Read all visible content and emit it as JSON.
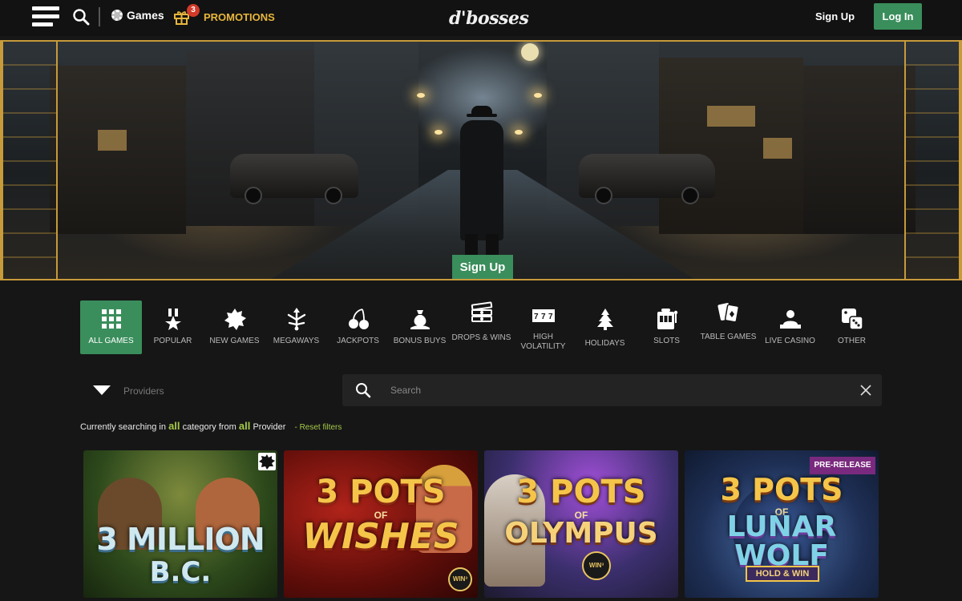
{
  "header": {
    "games_label": "Games",
    "promotions_count": "3",
    "promotions_label": "PROMOTIONS",
    "logo_text": "d'bosses",
    "signup_label": "Sign Up",
    "login_label": "Log In"
  },
  "hero": {
    "signup_label": "Sign Up"
  },
  "categories": [
    {
      "label": "ALL GAMES",
      "icon": "grid-icon",
      "active": true
    },
    {
      "label": "POPULAR",
      "icon": "medal-icon",
      "active": false
    },
    {
      "label": "NEW GAMES",
      "icon": "new-badge-icon",
      "active": false
    },
    {
      "label": "MEGAWAYS",
      "icon": "megaways-icon",
      "active": false
    },
    {
      "label": "JACKPOTS",
      "icon": "cherries-icon",
      "active": false
    },
    {
      "label": "BONUS BUYS",
      "icon": "money-bag-icon",
      "active": false
    },
    {
      "label": "DROPS & WINS",
      "icon": "coin-stack-icon",
      "active": false
    },
    {
      "label": "HIGH VOLATILITY",
      "icon": "triple-seven-icon",
      "active": false
    },
    {
      "label": "HOLIDAYS",
      "icon": "christmas-tree-icon",
      "active": false
    },
    {
      "label": "SLOTS",
      "icon": "slot-machine-icon",
      "active": false
    },
    {
      "label": "TABLE GAMES",
      "icon": "playing-cards-icon",
      "active": false
    },
    {
      "label": "LIVE CASINO",
      "icon": "dealer-icon",
      "active": false
    },
    {
      "label": "OTHER",
      "icon": "dice-icon",
      "active": false
    }
  ],
  "filters": {
    "providers_placeholder": "Providers",
    "search_placeholder": "Search",
    "search_value": ""
  },
  "status": {
    "prefix": "Currently searching in",
    "category": "all",
    "middle": "category from",
    "provider": "all",
    "suffix": "Provider",
    "reset_label": "- Reset filters"
  },
  "games": [
    {
      "title_line1": "3 MILLION",
      "title_line2": "B.C.",
      "badge": ""
    },
    {
      "title_line1": "3 POTS",
      "of_text": "OF",
      "title_line2": "WISHES",
      "badge": "WIN³"
    },
    {
      "title_line1": "3 POTS",
      "of_text": "OF",
      "title_line2": "OLYMPUS",
      "badge": "WIN³"
    },
    {
      "title_line1": "3 POTS",
      "of_text": "OF",
      "title_line2": "LUNAR WOLF",
      "feature": "HOLD & WIN",
      "badge": "PRE-RELEASE"
    }
  ],
  "colors": {
    "accent_green": "#3a8e5c",
    "promo_gold": "#e8b63c",
    "highlight_lime": "#a7c94a",
    "frame_gold": "#c79a3a"
  }
}
